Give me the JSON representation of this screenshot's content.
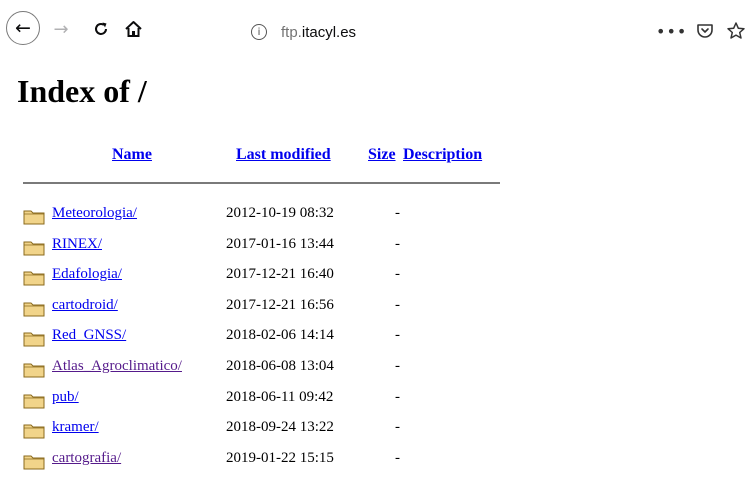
{
  "browser": {
    "url_host": "ftp.itacyl.es",
    "more_label": "•••"
  },
  "page": {
    "title": "Index of /",
    "columns": {
      "name": "Name",
      "last_modified": "Last modified",
      "size": "Size",
      "description": "Description"
    },
    "entries": [
      {
        "name": "Meteorologia/",
        "modified": "2012-10-19 08:32",
        "size": "-",
        "visited": false
      },
      {
        "name": "RINEX/",
        "modified": "2017-01-16 13:44",
        "size": "-",
        "visited": false
      },
      {
        "name": "Edafologia/",
        "modified": "2017-12-21 16:40",
        "size": "-",
        "visited": false
      },
      {
        "name": "cartodroid/",
        "modified": "2017-12-21 16:56",
        "size": "-",
        "visited": false
      },
      {
        "name": "Red_GNSS/",
        "modified": "2018-02-06 14:14",
        "size": "-",
        "visited": false
      },
      {
        "name": "Atlas_Agroclimatico/",
        "modified": "2018-06-08 13:04",
        "size": "-",
        "visited": true
      },
      {
        "name": "pub/",
        "modified": "2018-06-11 09:42",
        "size": "-",
        "visited": false
      },
      {
        "name": "kramer/",
        "modified": "2018-09-24 13:22",
        "size": "-",
        "visited": false
      },
      {
        "name": "cartografia/",
        "modified": "2019-01-22 15:15",
        "size": "-",
        "visited": true
      }
    ]
  },
  "colors": {
    "link": "#0000ee",
    "visited_link": "#551a8b",
    "folder_fill": "#f1d48a",
    "folder_stroke": "#8a6a1c"
  }
}
